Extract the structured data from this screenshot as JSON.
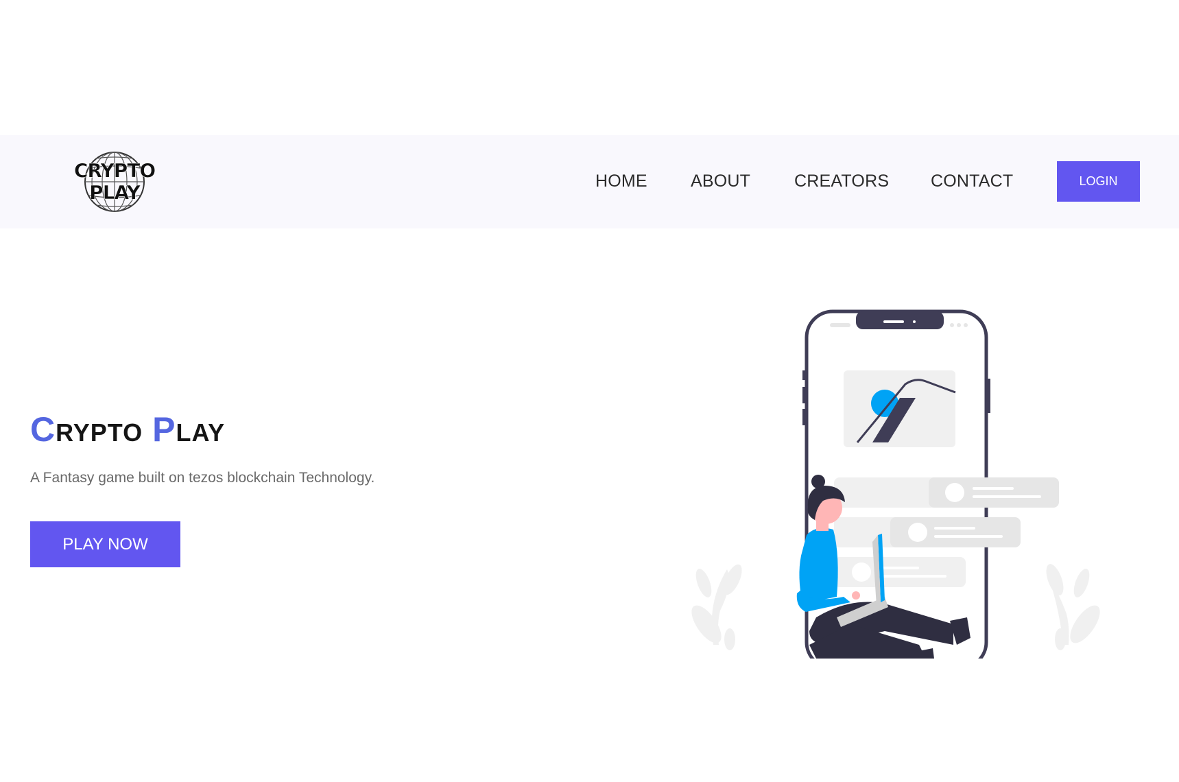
{
  "brand": {
    "logo_line1": "CRYPTO",
    "logo_line2": "PLAY"
  },
  "nav": {
    "items": [
      {
        "label": "HOME"
      },
      {
        "label": "ABOUT"
      },
      {
        "label": "CREATORS"
      },
      {
        "label": "CONTACT"
      }
    ],
    "login_label": "LOGIN"
  },
  "hero": {
    "title_word1_initial": "C",
    "title_word1_rest": "RYPTO",
    "title_word2_initial": "P",
    "title_word2_rest": "LAY",
    "subtitle": "A Fantasy game built on tezos blockchain Technology.",
    "cta_label": "PLAY NOW"
  },
  "colors": {
    "accent": "#6256f0",
    "title_initial": "#5466e0",
    "illustration_blue": "#00a3f5",
    "illustration_dark": "#3f3d56",
    "navbar_bg": "#f9f8fd"
  },
  "icons": {
    "logo": "globe-logo",
    "illustration": "woman-with-laptop-and-phone-illustration"
  }
}
